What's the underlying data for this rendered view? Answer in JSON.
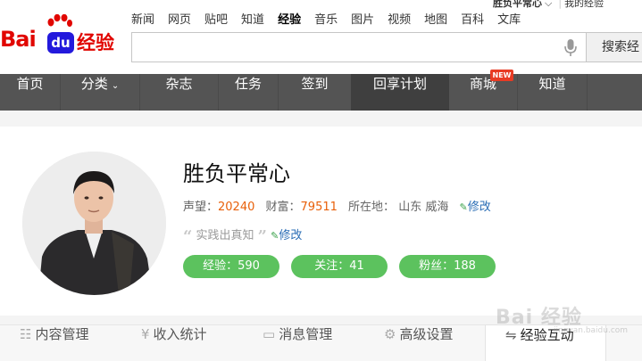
{
  "brand": {
    "logo_left": "Bai",
    "logo_du": "du",
    "logo_right": "经验",
    "color": "#e10601",
    "du_color": "#2319dc"
  },
  "top_nav": [
    "新闻",
    "网页",
    "贴吧",
    "知道",
    "经验",
    "音乐",
    "图片",
    "视频",
    "地图",
    "百科",
    "文库"
  ],
  "top_nav_active": "经验",
  "user_bar": {
    "username": "胜负平常心",
    "separator": "|",
    "my_experience": "我的经验"
  },
  "search": {
    "placeholder": "",
    "button": "搜索经"
  },
  "main_nav": {
    "items": [
      "首页",
      "分类",
      "杂志",
      "任务",
      "签到",
      "回享计划",
      "商城",
      "知道"
    ],
    "selected": "回享计划",
    "badge": "NEW",
    "bg": "#545454"
  },
  "profile": {
    "name": "胜负平常心",
    "prestige_label": "声望：",
    "prestige": "20240",
    "wealth_label": "财富：",
    "wealth": "79511",
    "location_label": "所在地：",
    "location": "山东 威海",
    "edit": "修改",
    "motto": "实践出真知",
    "motto_edit": "修改",
    "pills": [
      "经验：590",
      "关注：41",
      "粉丝：188"
    ],
    "pill_color": "#5cc25e"
  },
  "tabs": [
    "内容管理",
    "收入统计",
    "消息管理",
    "高级设置",
    "经验互动"
  ],
  "tab_selected": "经验互动",
  "watermark": {
    "text": "Bai 经验",
    "url": "jingyan.baidu.com"
  }
}
